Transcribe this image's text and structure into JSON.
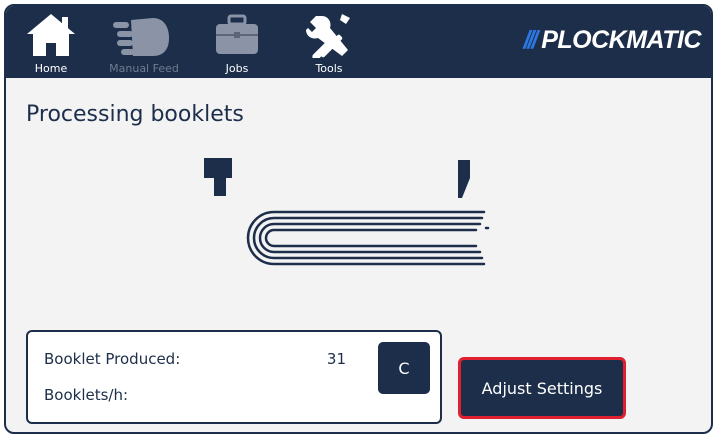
{
  "nav": {
    "items": [
      {
        "label": "Home",
        "icon": "home-icon",
        "enabled": true
      },
      {
        "label": "Manual Feed",
        "icon": "hand-icon",
        "enabled": false
      },
      {
        "label": "Jobs",
        "icon": "briefcase-icon",
        "enabled": false
      },
      {
        "label": "Tools",
        "icon": "tools-icon",
        "enabled": true
      }
    ]
  },
  "brand": {
    "slashes": "///",
    "name": "PLOCKMATIC"
  },
  "main": {
    "title": "Processing booklets",
    "stats": {
      "produced_label": "Booklet Produced:",
      "produced_value": "31",
      "rate_label": "Booklets/h:",
      "rate_value": "",
      "clear_label": "C"
    },
    "adjust_label": "Adjust Settings"
  },
  "colors": {
    "primary": "#1c2e4a",
    "brand_accent": "#2d77e1",
    "highlight": "#e0202f",
    "background": "#f3f3f4"
  }
}
